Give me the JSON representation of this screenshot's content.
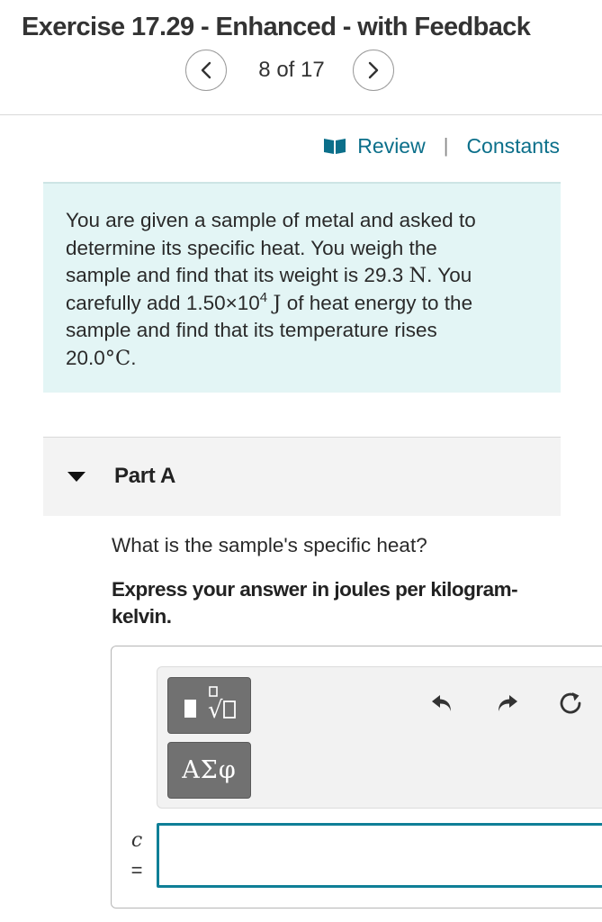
{
  "header": {
    "title": "Exercise 17.29 - Enhanced - with Feedback",
    "pager": "8 of 17",
    "prev_icon": "chevron-left-icon",
    "next_icon": "chevron-right-icon"
  },
  "links": {
    "icon": "book-icon",
    "review": "Review",
    "separator": "|",
    "constants": "Constants",
    "color": "#0b6f8a"
  },
  "problem": {
    "line1": "You are given a sample of metal and asked to",
    "line2": "determine its specific heat. You weigh the",
    "line3_pre": "sample and find that its weight is 29.3 ",
    "line3_unit": "N",
    "line3_post": ". You",
    "line4_pre": "carefully add 1.50×10",
    "line4_exp": "4",
    "line4_unit": "J",
    "line4_post": " of heat energy to the",
    "line5": "sample and find that its temperature rises",
    "line6_value": "20.0",
    "line6_unit": "°C",
    "line6_post": ".",
    "background": "#e3f5f5"
  },
  "part": {
    "title": "Part A",
    "caret_icon": "caret-down-icon",
    "question": "What is the sample's specific heat?",
    "instruction": "Express your answer in joules per kilogram-kelvin."
  },
  "answer": {
    "templates_icon": "templates-radical-icon",
    "symbols_label": "ΑΣφ",
    "undo_icon": "undo-icon",
    "redo_icon": "redo-icon",
    "reset_icon": "reset-icon",
    "variable": "c",
    "equals": "=",
    "value": "",
    "input_border": "#0f7f97"
  }
}
